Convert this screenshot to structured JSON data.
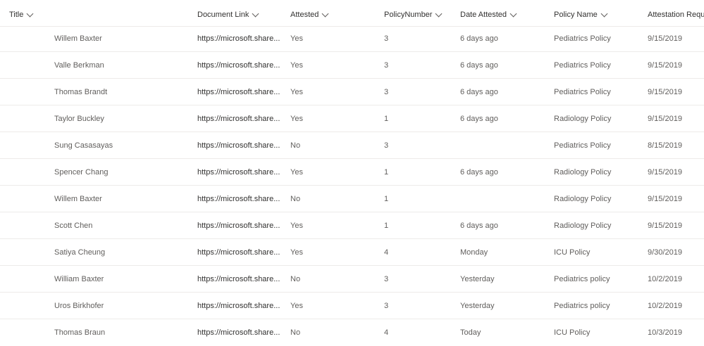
{
  "columns": [
    {
      "label": "Title"
    },
    {
      "label": "Document Link"
    },
    {
      "label": "Attested"
    },
    {
      "label": "PolicyNumber"
    },
    {
      "label": "Date Attested"
    },
    {
      "label": "Policy Name"
    },
    {
      "label": "Attestation Reque"
    }
  ],
  "rows": [
    {
      "title": "Willem Baxter",
      "doc": "https://microsoft.share...",
      "attested": "Yes",
      "num": "3",
      "date": "6 days ago",
      "policy": "Pediatrics Policy",
      "req": "9/15/2019"
    },
    {
      "title": "Valle Berkman",
      "doc": "https://microsoft.share...",
      "attested": "Yes",
      "num": "3",
      "date": "6 days ago",
      "policy": "Pediatrics Policy",
      "req": "9/15/2019"
    },
    {
      "title": "Thomas Brandt",
      "doc": "https://microsoft.share...",
      "attested": "Yes",
      "num": "3",
      "date": "6 days ago",
      "policy": "Pediatrics Policy",
      "req": "9/15/2019"
    },
    {
      "title": "Taylor Buckley",
      "doc": "https://microsoft.share...",
      "attested": "Yes",
      "num": "1",
      "date": "6 days ago",
      "policy": "Radiology Policy",
      "req": "9/15/2019"
    },
    {
      "title": "Sung Casasayas",
      "doc": "https://microsoft.share...",
      "attested": "No",
      "num": "3",
      "date": "",
      "policy": "Pediatrics Policy",
      "req": "8/15/2019"
    },
    {
      "title": "Spencer Chang",
      "doc": "https://microsoft.share...",
      "attested": "Yes",
      "num": "1",
      "date": "6 days ago",
      "policy": "Radiology Policy",
      "req": "9/15/2019"
    },
    {
      "title": "Willem Baxter",
      "doc": "https://microsoft.share...",
      "attested": "No",
      "num": "1",
      "date": "",
      "policy": "Radiology Policy",
      "req": "9/15/2019"
    },
    {
      "title": "Scott Chen",
      "doc": "https://microsoft.share...",
      "attested": "Yes",
      "num": "1",
      "date": "6 days ago",
      "policy": "Radiology Policy",
      "req": "9/15/2019"
    },
    {
      "title": "Satiya Cheung",
      "doc": "https://microsoft.share...",
      "attested": "Yes",
      "num": "4",
      "date": "Monday",
      "policy": "ICU Policy",
      "req": "9/30/2019"
    },
    {
      "title": "William Baxter",
      "doc": "https://microsoft.share...",
      "attested": "No",
      "num": "3",
      "date": "Yesterday",
      "policy": "Pediatrics policy",
      "req": "10/2/2019"
    },
    {
      "title": "Uros Birkhofer",
      "doc": "https://microsoft.share...",
      "attested": "Yes",
      "num": "3",
      "date": "Yesterday",
      "policy": "Pediatrics policy",
      "req": "10/2/2019"
    },
    {
      "title": "Thomas Braun",
      "doc": "https://microsoft.share...",
      "attested": "No",
      "num": "4",
      "date": "Today",
      "policy": "ICU Policy",
      "req": "10/3/2019"
    }
  ]
}
